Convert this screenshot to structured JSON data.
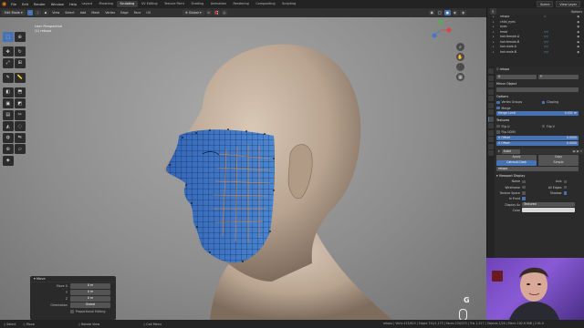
{
  "topbar": {
    "menus": [
      "File",
      "Edit",
      "Render",
      "Window",
      "Help"
    ],
    "workspaces": [
      "Layout",
      "Modeling",
      "Sculpting",
      "UV Editing",
      "Texture Paint",
      "Shading",
      "Animation",
      "Rendering",
      "Compositing",
      "Scripting"
    ],
    "active_workspace": "Sculpting",
    "scene": "Scene",
    "view_layer": "View Layer"
  },
  "viewport": {
    "mode": "Edit Mode",
    "header_menus": [
      "View",
      "Select",
      "Add",
      "Mesh",
      "Vertex",
      "Edge",
      "Face",
      "UV"
    ],
    "transform": "Global",
    "perspective_label": "User Perspective",
    "object_label": "(1) retopo",
    "overlay_letter": "G"
  },
  "operator_panel": {
    "title": "Move",
    "rows": [
      {
        "label": "Move X",
        "value": "0 m"
      },
      {
        "label": "Y",
        "value": "0 m"
      },
      {
        "label": "Z",
        "value": "0 m"
      },
      {
        "label": "Orientation",
        "value": "Global"
      }
    ],
    "proportional_label": "Proportional Editing"
  },
  "statusbar": {
    "items": [
      "Select",
      "Move",
      "Rotate View",
      "Call Menu"
    ],
    "stats": "retopo | Verts 413/820 | Edges 744/1,173 | Faces 234/372 | Tris 1,317 | Objects 1/20 | Mem: 182.6 MiB | 2.91.0"
  },
  "outliner": {
    "options_label": "Options",
    "rows": [
      {
        "name": "retopo",
        "mod": "▽"
      },
      {
        "name": "child_eyes",
        "mod": ""
      },
      {
        "name": "eyes",
        "mod": ""
      },
      {
        "name": "head",
        "mod": "▽▽"
      },
      {
        "name": "hair.female.A",
        "mod": "▽▽"
      },
      {
        "name": "hair.female.B",
        "mod": "▽▽"
      },
      {
        "name": "hair.male.A",
        "mod": "▽▽"
      },
      {
        "name": "hair.male.B",
        "mod": "▽▽"
      }
    ]
  },
  "properties": {
    "object_name": "retopo",
    "mirror": {
      "title": "Mirror Object",
      "options_label": "Options",
      "vertex_groups": "Vertex Groups",
      "clipping": "Clipping",
      "merge": "Merge",
      "merge_limit_label": "Merge Limit",
      "merge_limit_value": "0.001 m"
    },
    "textures": {
      "title": "Textures",
      "flip_u": "Flip U",
      "flip_v": "Flip V",
      "flip_udim": "Flip UDIM",
      "u_offset_label": "U Offset",
      "u_offset_value": "0.0000",
      "v_offset_label": "V Offset",
      "v_offset_value": "0.0000"
    },
    "subsurf": {
      "name": "Subd",
      "apply": "Apply",
      "copy": "Copy",
      "catmull": "Catmull-Clark",
      "simple": "Simple",
      "target": "retopo"
    },
    "viewport_display": {
      "title": "Viewport Display",
      "name_label": "Name",
      "axis_label": "Axis",
      "wireframe_label": "Wireframe",
      "all_edges_label": "All Edges",
      "texture_space_label": "Texture Space",
      "shadow_label": "Shadow",
      "in_front_label": "In Front",
      "display_as_label": "Display As",
      "display_as_value": "Textured",
      "color_label": "Color"
    }
  },
  "colors": {
    "accent": "#4772b3",
    "mesh_blue": "#3a78c8",
    "skin": "#c8b6a4"
  }
}
